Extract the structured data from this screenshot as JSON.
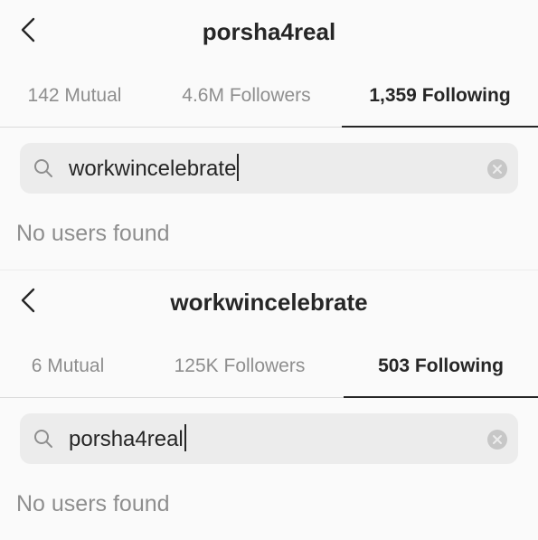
{
  "colors": {
    "background": "#fafafa",
    "text_primary": "#262626",
    "text_secondary": "#8e8e8e",
    "search_bg": "#ececec"
  },
  "icons": {
    "back": "chevron-left-icon",
    "search": "search-icon",
    "clear": "clear-circle-icon"
  },
  "panels": [
    {
      "title": "porsha4real",
      "tabs": [
        {
          "label": "142 Mutual",
          "active": false
        },
        {
          "label": "4.6M Followers",
          "active": false
        },
        {
          "label": "1,359 Following",
          "active": true
        }
      ],
      "search": {
        "value": "workwincelebrate"
      },
      "empty_message": "No users found"
    },
    {
      "title": "workwincelebrate",
      "tabs": [
        {
          "label": "6 Mutual",
          "active": false
        },
        {
          "label": "125K Followers",
          "active": false
        },
        {
          "label": "503 Following",
          "active": true
        }
      ],
      "search": {
        "value": "porsha4real"
      },
      "empty_message": "No users found"
    }
  ]
}
